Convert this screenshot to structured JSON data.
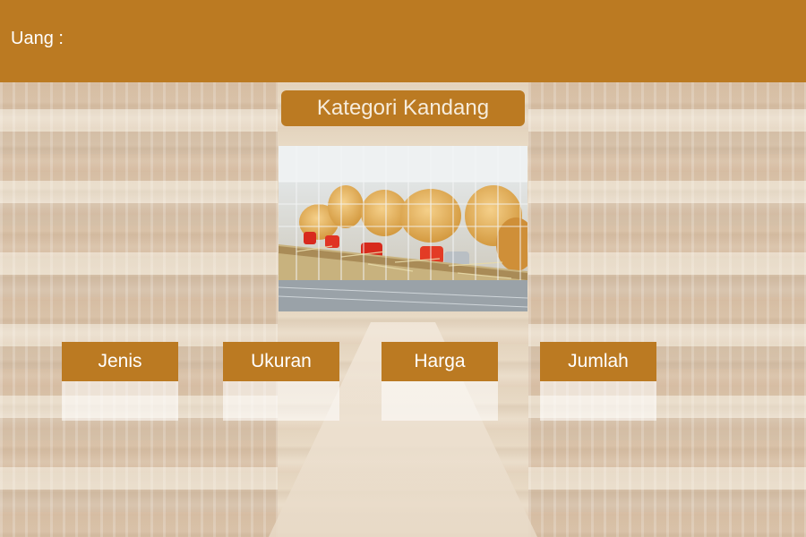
{
  "header": {
    "money_label": "Uang :",
    "money_value": ""
  },
  "title": "Kategori Kandang",
  "image": {
    "icon": "chicken-cage-photo"
  },
  "columns": [
    {
      "label": "Jenis",
      "value": ""
    },
    {
      "label": "Ukuran",
      "value": ""
    },
    {
      "label": "Harga",
      "value": ""
    },
    {
      "label": "Jumlah",
      "value": ""
    }
  ],
  "colors": {
    "accent": "#bb7a22",
    "title_text": "#f6ecdc",
    "panel": "#ffffff"
  }
}
